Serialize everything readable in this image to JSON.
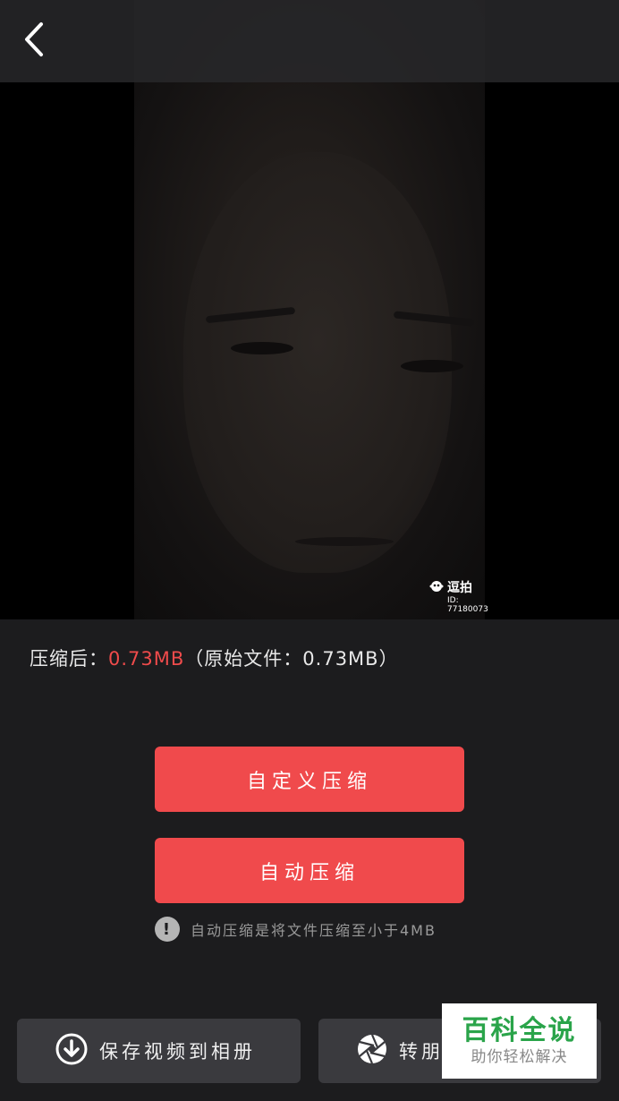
{
  "topbar": {
    "back_icon": "chevron-left-icon"
  },
  "video": {
    "watermark_title": "逗拍",
    "watermark_id_label": "ID:",
    "watermark_id": "77180073"
  },
  "size_info": {
    "label": "压缩后：",
    "compressed_size": "0.73MB",
    "original_text": "（原始文件：0.73MB）"
  },
  "buttons": {
    "custom_compress": "自定义压缩",
    "auto_compress": "自动压缩"
  },
  "hint": {
    "icon": "exclamation-icon",
    "text": "自动压缩是将文件压缩至小于4MB"
  },
  "bottom": {
    "save_label": "保存视频到相册",
    "save_icon": "download-icon",
    "share_label": "转朋",
    "share_icon": "aperture-icon"
  },
  "brand": {
    "title": "百科全说",
    "subtitle": "助你轻松解决"
  },
  "colors": {
    "accent": "#f04a4c",
    "background": "#1c1c1e",
    "bottom_button": "#3a3a3e",
    "brand_green": "#2aa44a"
  }
}
